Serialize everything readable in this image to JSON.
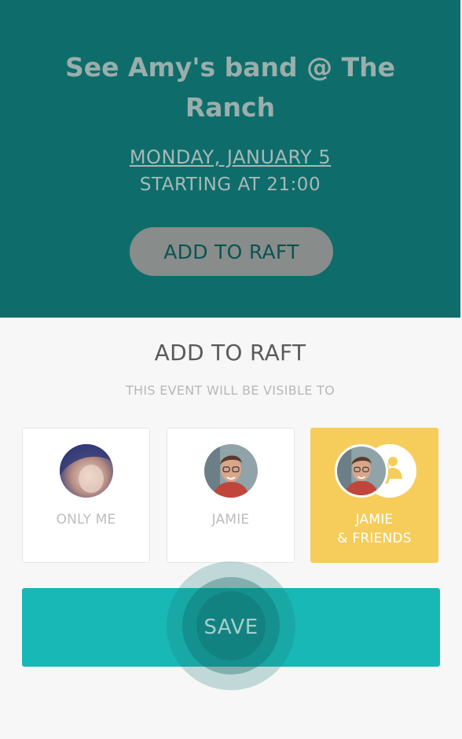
{
  "event": {
    "title": "See Amy's band @ The Ranch",
    "date": "MONDAY, JANUARY 5",
    "time": "STARTING AT 21:00",
    "add_button_label": "ADD TO RAFT"
  },
  "panel": {
    "title": "ADD TO RAFT",
    "subtitle": "THIS EVENT WILL BE VISIBLE TO"
  },
  "visibility_options": [
    {
      "label": "ONLY ME",
      "selected": false,
      "avatar": "user-avatar"
    },
    {
      "label": "JAMIE",
      "selected": false,
      "avatar": "jamie-avatar"
    },
    {
      "label": "JAMIE\n& FRIENDS",
      "selected": true,
      "avatar": "jamie-avatar",
      "secondary_icon": "friends-icon"
    }
  ],
  "save_label": "SAVE",
  "colors": {
    "hero_bg": "#0e6d6b",
    "accent": "#17b8b5",
    "selected": "#f6cd5a"
  }
}
